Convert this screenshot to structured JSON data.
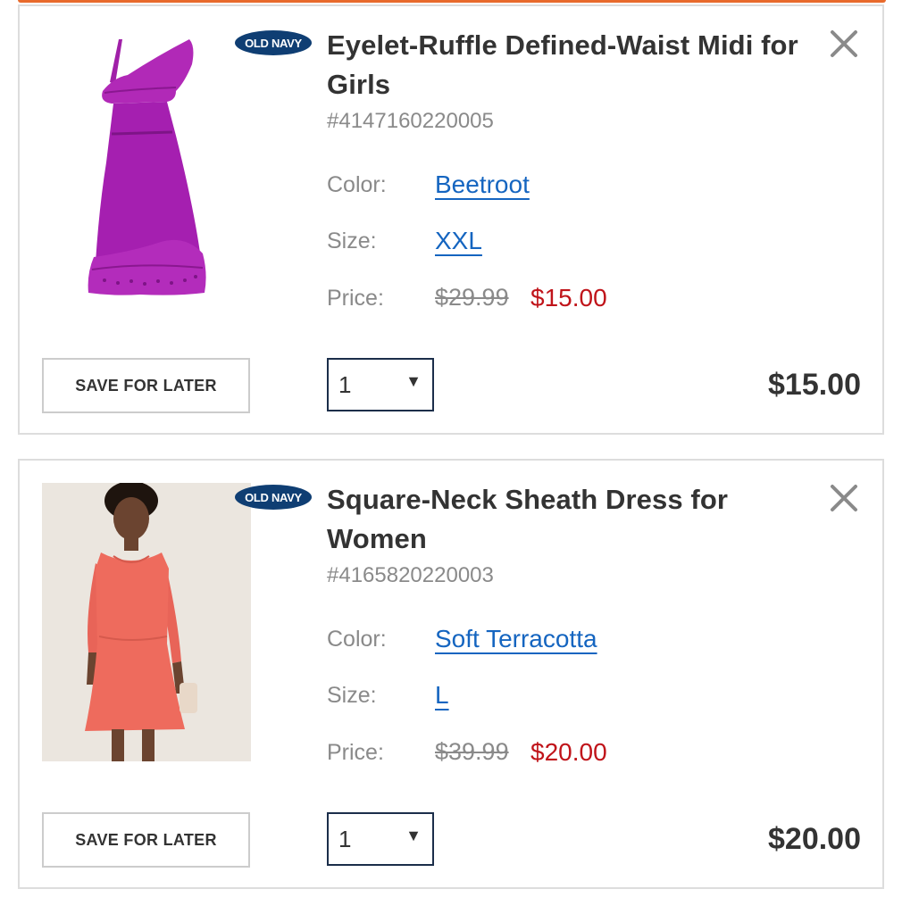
{
  "cart": {
    "items": [
      {
        "brand": "OLD NAVY",
        "title": "Eyelet-Ruffle Defined-Waist Midi for Girls",
        "sku": "#4147160220005",
        "color_label": "Color:",
        "color_value": "Beetroot",
        "size_label": "Size:",
        "size_value": "XXL",
        "price_label": "Price:",
        "original_price": "$29.99",
        "sale_price": "$15.00",
        "save_label": "SAVE FOR LATER",
        "quantity": "1",
        "total": "$15.00",
        "image_alt": "purple-one-shoulder-ruffle-dress-image"
      },
      {
        "brand": "OLD NAVY",
        "title": "Square-Neck Sheath Dress for Women",
        "sku": "#4165820220003",
        "color_label": "Color:",
        "color_value": "Soft Terracotta",
        "size_label": "Size:",
        "size_value": "L",
        "price_label": "Price:",
        "original_price": "$39.99",
        "sale_price": "$20.00",
        "save_label": "SAVE FOR LATER",
        "quantity": "1",
        "total": "$20.00",
        "image_alt": "model-in-coral-sheath-dress-image"
      }
    ]
  },
  "colors": {
    "accent_strip": "#e86a2c",
    "link": "#1565c0",
    "sale": "#c0141a",
    "brand_badge": "#0f3e73",
    "text": "#333333",
    "muted": "#8a8a8a"
  },
  "icons": {
    "remove": "close-x-icon",
    "dropdown": "triangle-down-icon"
  }
}
